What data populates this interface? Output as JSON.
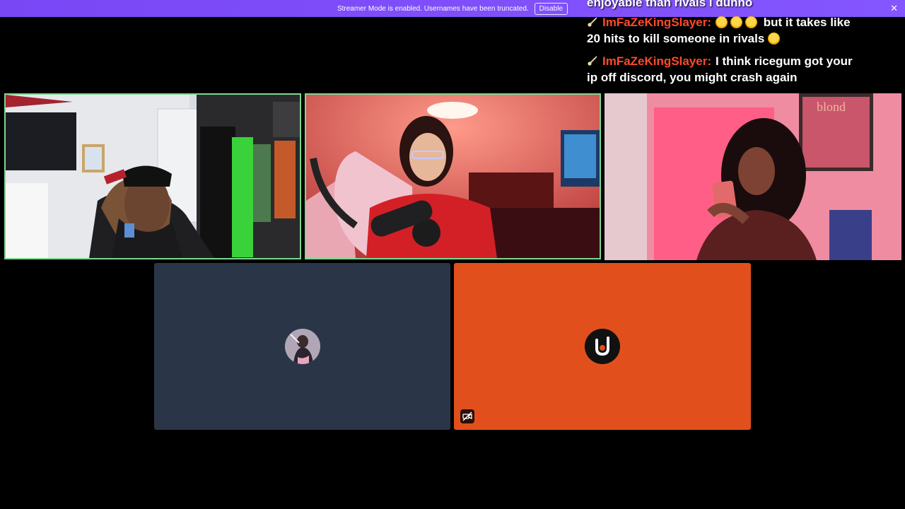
{
  "banner": {
    "message": "Streamer Mode is enabled. Usernames have been truncated.",
    "disable_label": "Disable",
    "close_glyph": "✕",
    "background": "#7c4dff"
  },
  "chat": {
    "partial_line": "enjoyable than rivals i dunno",
    "messages": [
      {
        "badge": "guitar-badge-icon",
        "user": "ImFaZeKingSlayer:",
        "emoji_count": 3,
        "line1_text": "but it takes like",
        "line2_text": "20 hits to kill someone in rivals",
        "trailing_emoji": "laughing-emoji-icon"
      },
      {
        "badge": "guitar-badge-icon",
        "user": "ImFaZeKingSlayer:",
        "line1_text": "I think ricegum got your",
        "line2_text": "ip off discord, you might crash again"
      }
    ],
    "username_color": "#ff4a2a"
  },
  "participants": [
    {
      "tile": "webcam-male-streamer",
      "speaking": true
    },
    {
      "tile": "webcam-female-streamer-red-room",
      "speaking": true
    },
    {
      "tile": "webcam-female-phone-pink-room",
      "speaking": false
    },
    {
      "tile": "avatar-only-dark",
      "speaking": false,
      "background": "#2a3647"
    },
    {
      "tile": "avatar-only-orange",
      "speaking": false,
      "muted": true,
      "background": "#e1501c"
    }
  ]
}
